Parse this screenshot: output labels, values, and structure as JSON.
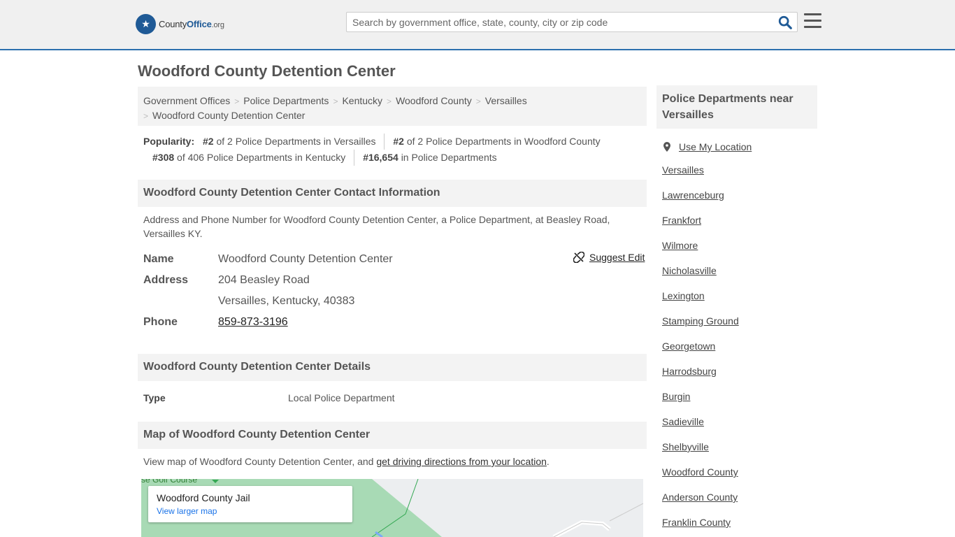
{
  "header": {
    "logo": {
      "text_a": "County",
      "text_b": "Office",
      "text_c": ".org"
    },
    "search_placeholder": "Search by government office, state, county, city or zip code"
  },
  "page_title": "Woodford County Detention Center",
  "breadcrumbs": [
    "Government Offices",
    "Police Departments",
    "Kentucky",
    "Woodford County",
    "Versailles",
    "Woodford County Detention Center"
  ],
  "popularity": {
    "label": "Popularity:",
    "items": [
      {
        "rank": "#2",
        "text": "of 2 Police Departments in Versailles"
      },
      {
        "rank": "#2",
        "text": "of 2 Police Departments in Woodford County"
      },
      {
        "rank": "#308",
        "text": "of 406 Police Departments in Kentucky"
      },
      {
        "rank": "#16,654",
        "text": "in Police Departments"
      }
    ]
  },
  "contact": {
    "heading": "Woodford County Detention Center Contact Information",
    "description": "Address and Phone Number for Woodford County Detention Center, a Police Department, at Beasley Road, Versailles KY.",
    "suggest_edit": "Suggest Edit",
    "name_label": "Name",
    "name": "Woodford County Detention Center",
    "address_label": "Address",
    "address_line1": "204 Beasley Road",
    "address_line2": "Versailles, Kentucky, 40383",
    "phone_label": "Phone",
    "phone": "859-873-3196"
  },
  "details": {
    "heading": "Woodford County Detention Center Details",
    "type_label": "Type",
    "type_value": "Local Police Department"
  },
  "map": {
    "heading": "Map of Woodford County Detention Center",
    "desc_prefix": "View map of Woodford County Detention Center, and ",
    "desc_link": "get driving directions from your location",
    "desc_suffix": ".",
    "card_title": "Woodford County Jail",
    "card_link": "View larger map",
    "place_label": "se Golf Course"
  },
  "sidebar": {
    "heading": "Police Departments near Versailles",
    "use_location": "Use My Location",
    "cities": [
      "Versailles",
      "Lawrenceburg",
      "Frankfort",
      "Wilmore",
      "Nicholasville",
      "Lexington",
      "Stamping Ground",
      "Georgetown",
      "Harrodsburg",
      "Burgin",
      "Sadieville",
      "Shelbyville",
      "Woodford County",
      "Anderson County",
      "Franklin County"
    ]
  },
  "colors": {
    "brand": "#1f5a96",
    "header_bg": "#f0f0f0",
    "section_bg": "#f3f3f3"
  }
}
